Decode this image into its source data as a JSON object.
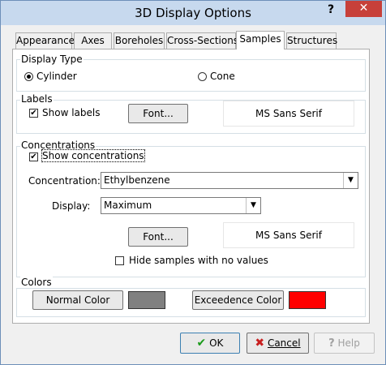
{
  "window": {
    "title": "3D Display Options",
    "help_glyph": "?",
    "close_glyph": "✕"
  },
  "tabs": [
    {
      "label": "Appearance"
    },
    {
      "label": "Axes"
    },
    {
      "label": "Boreholes"
    },
    {
      "label": "Cross-Sections"
    },
    {
      "label": "Samples",
      "active": true
    },
    {
      "label": "Structures"
    }
  ],
  "display_type": {
    "heading": "Display Type",
    "cylinder_label": "Cylinder",
    "cone_label": "Cone",
    "selected": "Cylinder"
  },
  "labels": {
    "heading": "Labels",
    "show_labels_label": "Show labels",
    "show_labels_checked": true,
    "font_button": "Font...",
    "font_preview": "MS Sans Serif"
  },
  "concentrations": {
    "heading": "Concentrations",
    "show_label": "Show concentrations",
    "show_checked": true,
    "concentration_label": "Concentration:",
    "concentration_value": "Ethylbenzene",
    "display_label": "Display:",
    "display_value": "Maximum",
    "font_button": "Font...",
    "font_preview": "MS Sans Serif",
    "hide_label": "Hide samples with no values",
    "hide_checked": false
  },
  "colors": {
    "heading": "Colors",
    "normal_button": "Normal Color",
    "normal_color": "#808080",
    "exceed_button": "Exceedence Color",
    "exceed_color": "#ff0000"
  },
  "footer": {
    "ok_label": "OK",
    "cancel_label": "Cancel",
    "help_label": "Help"
  }
}
